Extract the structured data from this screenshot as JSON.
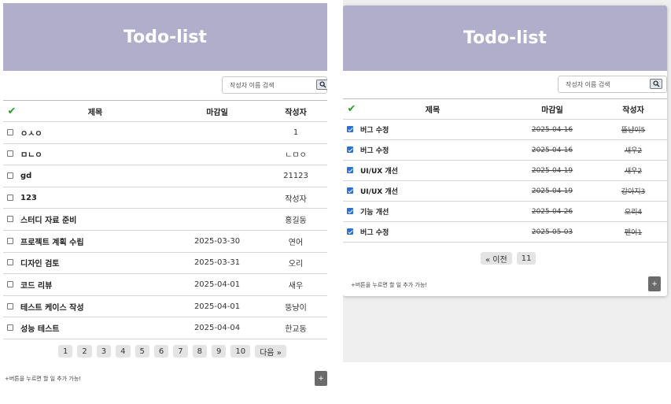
{
  "left": {
    "header_title": "Todo-list",
    "search_placeholder": "작성자 이름 검색",
    "columns": {
      "check": "✔",
      "title": "제목",
      "due": "마감일",
      "author": "작성자"
    },
    "rows": [
      {
        "title": "ㅇㅅㅇ",
        "due": "",
        "author": "1",
        "done": false
      },
      {
        "title": "ㅁㄴㅇ",
        "due": "",
        "author": "ㄴㅁㅇ",
        "done": false
      },
      {
        "title": "gd",
        "due": "",
        "author": "21123",
        "done": false
      },
      {
        "title": "123",
        "due": "",
        "author": "작성자",
        "done": false
      },
      {
        "title": "스터디 자료 준비",
        "due": "",
        "author": "홍길동",
        "done": false
      },
      {
        "title": "프로젝트 계획 수립",
        "due": "2025-03-30",
        "author": "연어",
        "done": false
      },
      {
        "title": "디자인 검토",
        "due": "2025-03-31",
        "author": "오리",
        "done": false
      },
      {
        "title": "코드 리뷰",
        "due": "2025-04-01",
        "author": "새우",
        "done": false
      },
      {
        "title": "테스트 케이스 작성",
        "due": "2025-04-01",
        "author": "뚱냥이",
        "done": false
      },
      {
        "title": "성능 테스트",
        "due": "2025-04-04",
        "author": "한교동",
        "done": false
      }
    ],
    "pagination": [
      "1",
      "2",
      "3",
      "4",
      "5",
      "6",
      "7",
      "8",
      "9",
      "10",
      "다음 »"
    ],
    "hint_text": "+버튼을 누르면 할 일 추가 가능!",
    "add_label": "+"
  },
  "right": {
    "header_title": "Todo-list",
    "search_placeholder": "작성자 이름 검색",
    "columns": {
      "check": "✔",
      "title": "제목",
      "due": "마감일",
      "author": "작성자"
    },
    "rows": [
      {
        "title": "버그 수정",
        "due": "2025-04-16",
        "author": "뚱냥이5",
        "done": true
      },
      {
        "title": "버그 수정",
        "due": "2025-04-16",
        "author": "새우2",
        "done": true
      },
      {
        "title": "UI/UX 개선",
        "due": "2025-04-19",
        "author": "새우2",
        "done": true
      },
      {
        "title": "UI/UX 개선",
        "due": "2025-04-19",
        "author": "강아지3",
        "done": true
      },
      {
        "title": "기능 개선",
        "due": "2025-04-26",
        "author": "오리4",
        "done": true
      },
      {
        "title": "버그 수정",
        "due": "2025-05-03",
        "author": "펜어1",
        "done": true
      }
    ],
    "pagination": [
      "« 이전",
      "11"
    ],
    "hint_text": "+버튼을 누르면 할 일 추가 가능!",
    "add_label": "+"
  },
  "colors": {
    "header_bg": "#b0aecb",
    "check_green": "#2a9d2a",
    "add_button": "#6b6b6b"
  }
}
